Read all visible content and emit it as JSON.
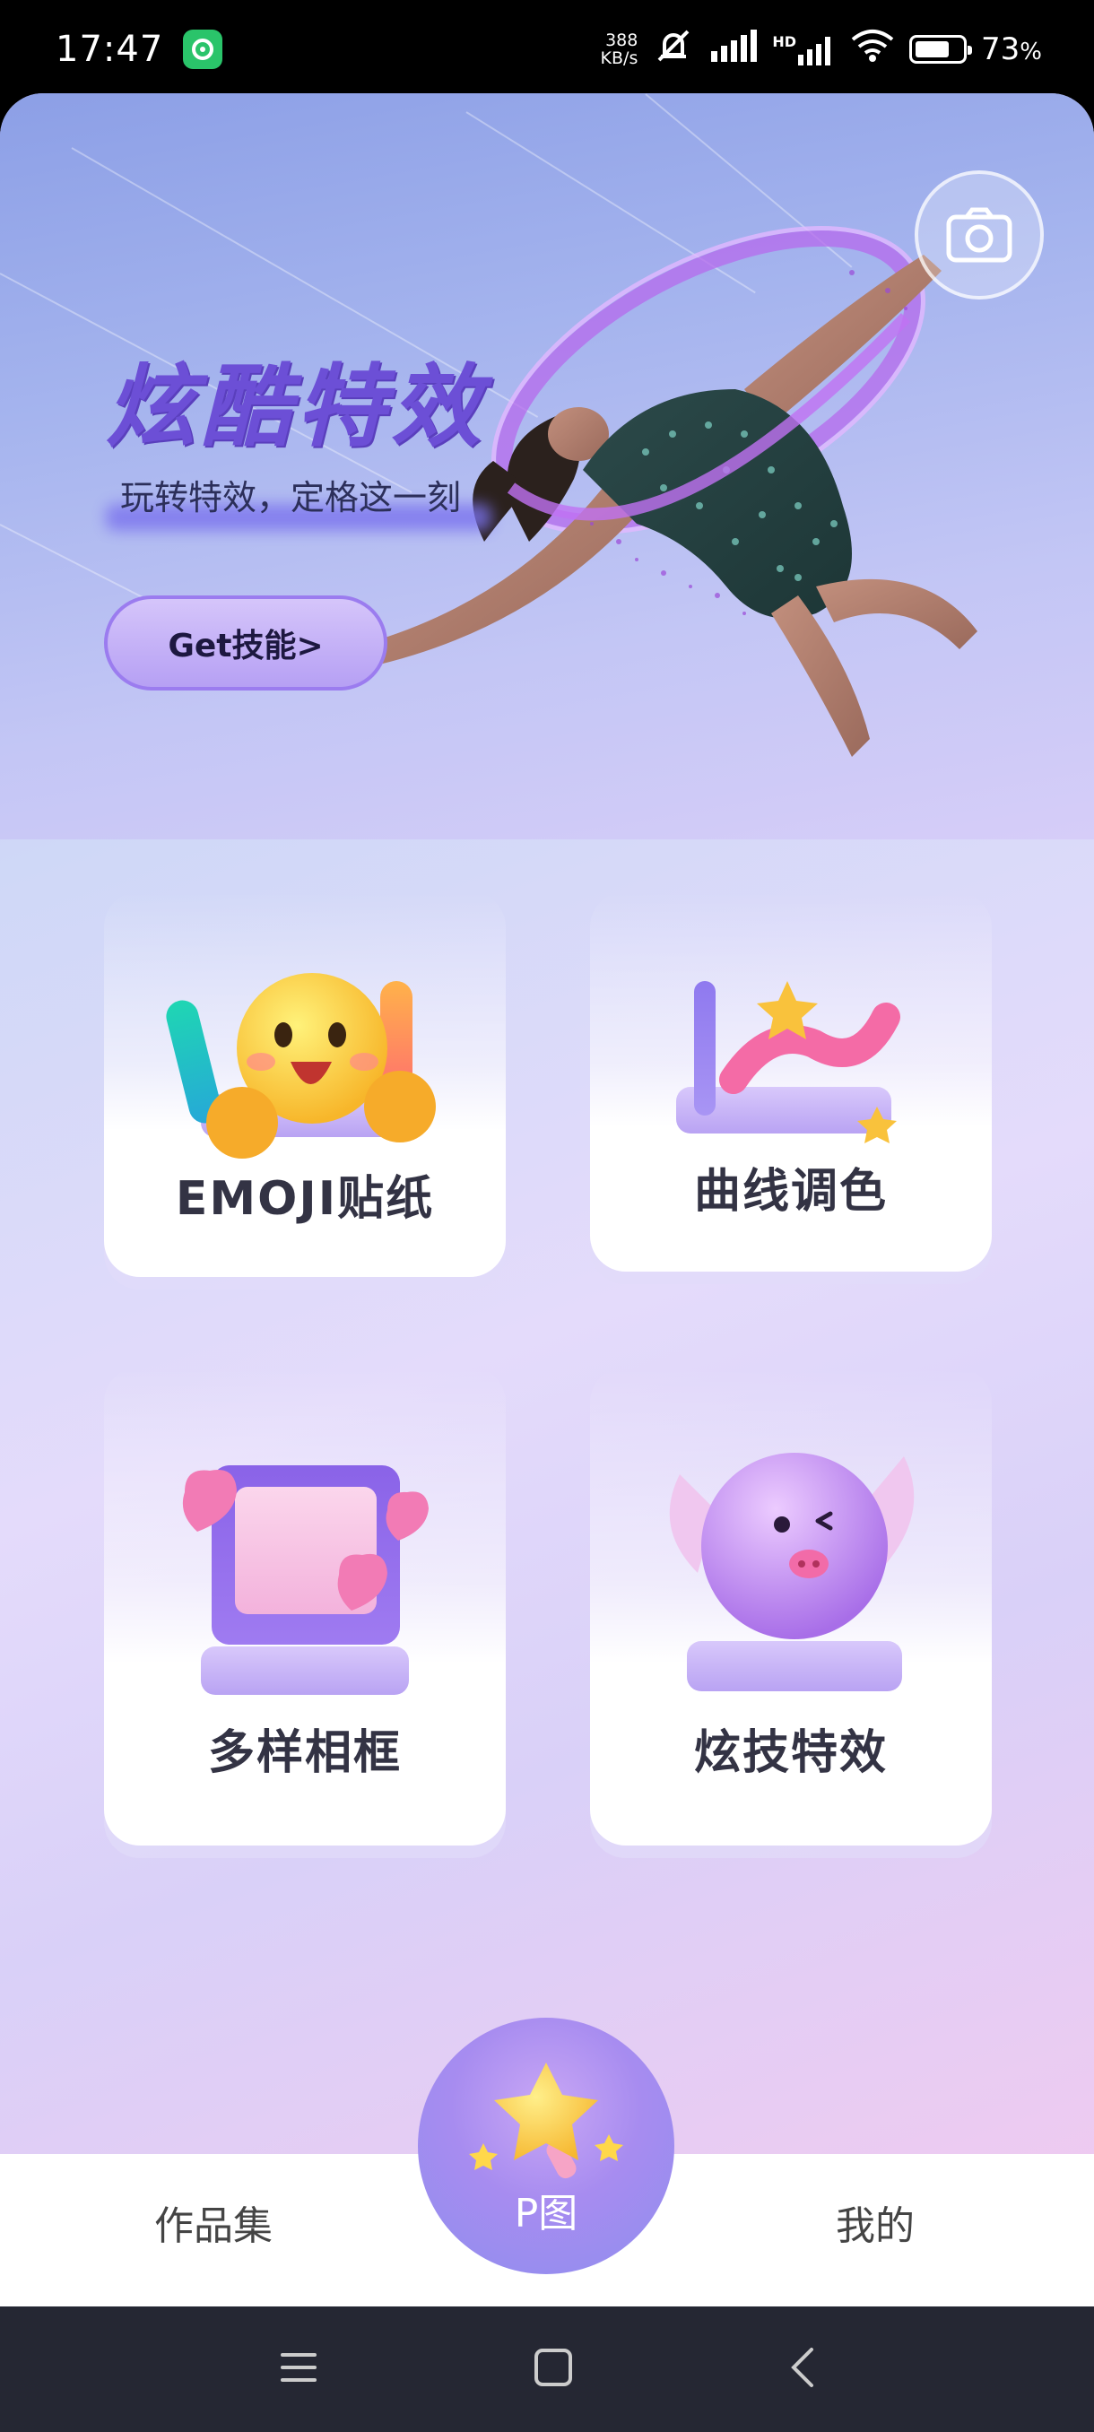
{
  "status_bar": {
    "time": "17:47",
    "net_speed_value": "388",
    "net_speed_unit": "KB/s",
    "network_label": "HD",
    "battery_percent": "73",
    "battery_suffix": "%",
    "battery_level": 0.73
  },
  "hero": {
    "title": "炫酷特效",
    "subtitle": "玩转特效，定格这一刻",
    "cta_label": "Get技能>"
  },
  "features": [
    {
      "label": "EMOJI贴纸",
      "icon": "emoji-sticker-icon"
    },
    {
      "label": "曲线调色",
      "icon": "curve-chart-icon"
    },
    {
      "label": "多样相框",
      "icon": "photo-frame-icon"
    },
    {
      "label": "炫技特效",
      "icon": "winged-ball-icon"
    }
  ],
  "bottom_nav": {
    "left_label": "作品集",
    "center_label": "P图",
    "right_label": "我的"
  },
  "colors": {
    "accent": "#6c4fd6",
    "hero_bg": "#a5b4ee",
    "fab": "#a78cf0"
  }
}
